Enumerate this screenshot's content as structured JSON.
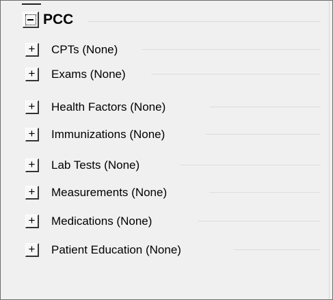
{
  "tree": {
    "root": {
      "label": "PCC",
      "expander_symbol": "-",
      "icon": "collapse-icon"
    },
    "children": [
      {
        "label": "CPTs (None)",
        "expander_symbol": "+"
      },
      {
        "label": "Exams (None)",
        "expander_symbol": "+"
      },
      {
        "label": "Health Factors (None)",
        "expander_symbol": "+"
      },
      {
        "label": "Immunizations (None)",
        "expander_symbol": "+"
      },
      {
        "label": "Lab Tests (None)",
        "expander_symbol": "+"
      },
      {
        "label": "Measurements (None)",
        "expander_symbol": "+"
      },
      {
        "label": "Medications (None)",
        "expander_symbol": "+"
      },
      {
        "label": "Patient Education (None)",
        "expander_symbol": "+"
      }
    ]
  },
  "colors": {
    "background": "#f0f0f0",
    "border": "#6b6b6b",
    "guide_line": "#dcdcdc"
  }
}
